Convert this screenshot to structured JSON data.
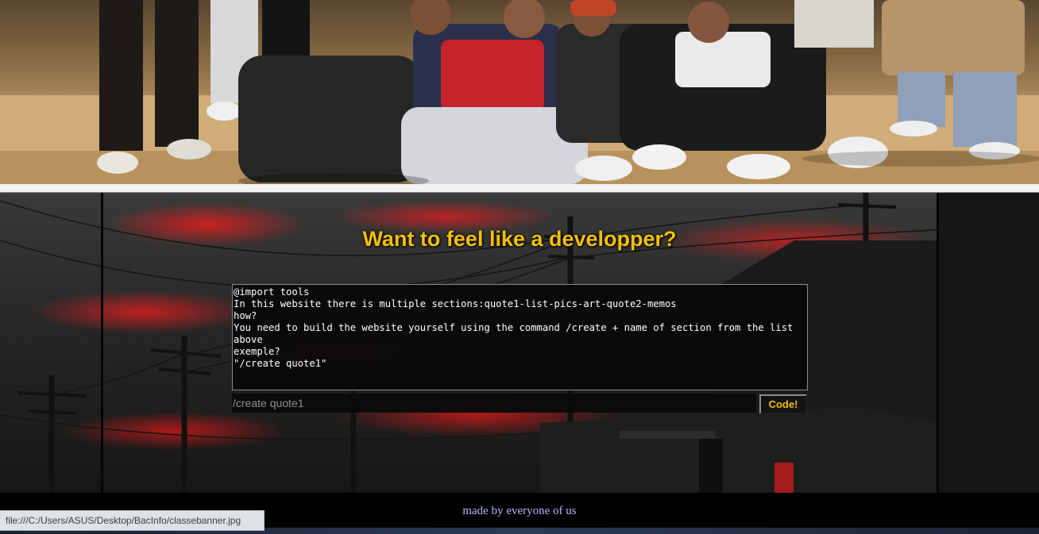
{
  "banner": {
    "image_name": "class-group-photo",
    "background_color": "#c7a36e"
  },
  "developer_section": {
    "title": "Want to feel like a developper?",
    "title_color": "#f5c000",
    "terminal_output": "@import tools\nIn this website there is multiple sections:quote1-list-pics-art-quote2-memos\nhow?\nYou need to build the website yourself using the command /create + name of section from the list above\nexemple?\n\"/create quote1\"",
    "command_placeholder": "/create quote1",
    "command_value": "",
    "code_button_label": "Code!",
    "accent_color": "#e01f1f"
  },
  "footer": {
    "text": "made by everyone of us",
    "text_color": "#b4b4ff"
  },
  "status_bar": {
    "url": "file:///C:/Users/ASUS/Desktop/BacInfo/classebanner.jpg"
  }
}
